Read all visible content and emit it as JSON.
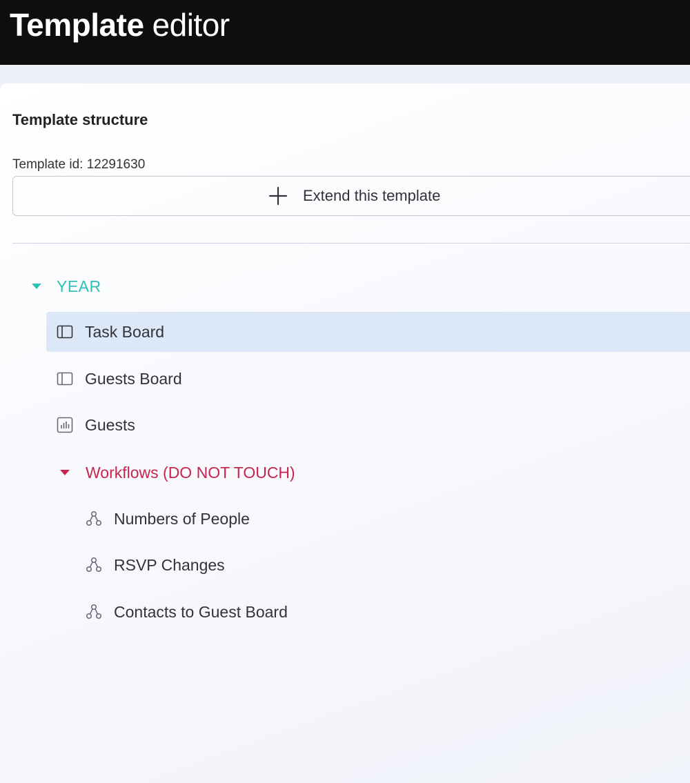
{
  "header": {
    "title_bold": "Template",
    "title_light": "editor"
  },
  "panel": {
    "title": "Template structure",
    "template_id_text": "Template id: 12291630",
    "extend_button_label": "Extend this template"
  },
  "tree": {
    "root": {
      "label": "YEAR",
      "color": "#2fc1b5",
      "expanded": true
    },
    "items": [
      {
        "label": "Task Board",
        "icon": "board-icon",
        "selected": true
      },
      {
        "label": "Guests Board",
        "icon": "board-icon",
        "selected": false
      },
      {
        "label": "Guests",
        "icon": "dashboard-icon",
        "selected": false
      }
    ],
    "folder": {
      "label": "Workflows (DO NOT TOUCH)",
      "color": "#c8254e",
      "expanded": true,
      "items": [
        {
          "label": "Numbers of People",
          "icon": "workflow-icon"
        },
        {
          "label": "RSVP Changes",
          "icon": "workflow-icon"
        },
        {
          "label": "Contacts to Guest Board",
          "icon": "workflow-icon"
        }
      ]
    }
  },
  "colors": {
    "header_bg": "#0e0e0e",
    "selected_row_bg": "#dce7f7"
  }
}
